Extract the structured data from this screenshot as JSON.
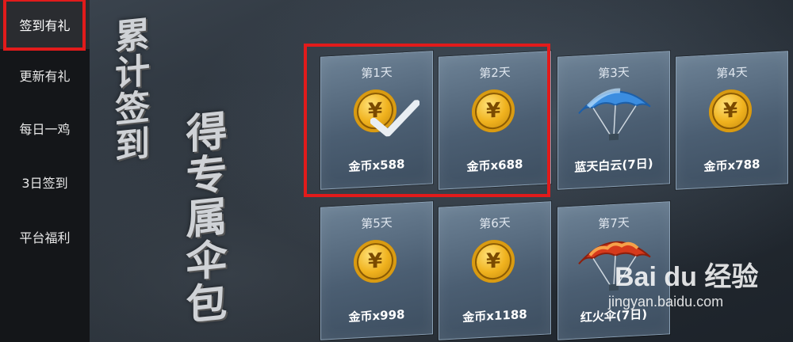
{
  "sidebar": {
    "items": [
      {
        "label": "签到有礼",
        "active": true
      },
      {
        "label": "更新有礼",
        "active": false
      },
      {
        "label": "每日一鸡",
        "active": false
      },
      {
        "label": "3日签到",
        "active": false
      },
      {
        "label": "平台福利",
        "active": false
      }
    ]
  },
  "slogan": {
    "line1": "累计签到",
    "line2": "得专属伞包"
  },
  "rewards": [
    {
      "day": "第1天",
      "label": "金币x588",
      "icon": "coin-icon",
      "claimed": true
    },
    {
      "day": "第2天",
      "label": "金币x688",
      "icon": "coin-icon",
      "claimed": false
    },
    {
      "day": "第3天",
      "label": "蓝天白云(7日)",
      "icon": "blue-parachute-icon",
      "claimed": false
    },
    {
      "day": "第4天",
      "label": "金币x788",
      "icon": "coin-icon",
      "claimed": false
    },
    {
      "day": "第5天",
      "label": "金币x998",
      "icon": "coin-icon",
      "claimed": false
    },
    {
      "day": "第6天",
      "label": "金币x1188",
      "icon": "coin-icon",
      "claimed": false
    },
    {
      "day": "第7天",
      "label": "红火伞(7日)",
      "icon": "red-parachute-icon",
      "claimed": false
    }
  ],
  "coin_symbol": "¥",
  "watermark": {
    "brand": "Bai du 经验",
    "url": "jingyan.baidu.com"
  },
  "colors": {
    "highlight": "#e21b1b",
    "coin": "#f0b21e",
    "card": "#4b5e72"
  }
}
